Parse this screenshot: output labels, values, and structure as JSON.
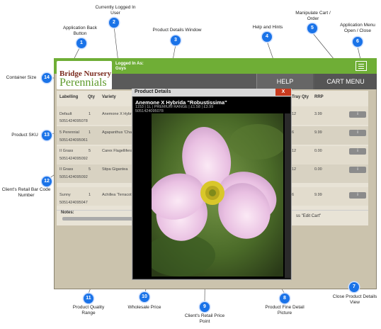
{
  "app": {
    "logo_line1": "Bridge Nursery",
    "logo_line2": "Perennials",
    "logged_in_label": "Logged In As:",
    "logged_in_user": "Guys",
    "help_label": "HELP",
    "cart_label": "CART MENU",
    "brand_color": "#6fae36"
  },
  "table": {
    "headers": [
      "Labelling",
      "Qty",
      "Variety",
      "Tray Qty",
      "RRP"
    ],
    "rows": [
      {
        "labelling": "Default",
        "qty": "1",
        "variety": "Anemone X Hybr...",
        "barcode": "5051424095078",
        "tray_qty": "12",
        "rrp": "3.99"
      },
      {
        "labelling": "5 Perennial",
        "qty": "1",
        "variety": "Agapanthus 'Cha...",
        "barcode": "5051424095061",
        "tray_qty": "6",
        "rrp": "9.99"
      },
      {
        "labelling": "II Grass",
        "qty": "5",
        "variety": "Carex Flagellifera",
        "barcode": "5051424095092",
        "tray_qty": "12",
        "rrp": "0.00"
      },
      {
        "labelling": "II Grass",
        "qty": "5",
        "variety": "Stipa Gigantea",
        "barcode": "5051424095092",
        "tray_qty": "12",
        "rrp": "0.00"
      },
      {
        "labelling": "Sunny",
        "qty": "1",
        "variety": "Achillea 'Terracott...",
        "barcode": "5051424095047",
        "tray_qty": "6",
        "rrp": "9.99"
      }
    ],
    "info_label": "i",
    "notes_label": "Notes:",
    "edit_cart_hint": "ss \"Edit Cart\""
  },
  "modal": {
    "title": "Product Details",
    "close_label": "X",
    "product_name": "Anemone X Hybrida \"Robustissima\"",
    "product_info": "1153 | 1L | PREMIUM RANGE | £1.58 | £3.99",
    "product_barcode": "5051424095078"
  },
  "annotations": [
    {
      "num": "1",
      "text": "Application Back Button"
    },
    {
      "num": "2",
      "text": "Currently Logged In User"
    },
    {
      "num": "3",
      "text": "Product Details Window"
    },
    {
      "num": "4",
      "text": "Help and Hints"
    },
    {
      "num": "5",
      "text": "Manipulate Cart / Order"
    },
    {
      "num": "6",
      "text": "Application Menu Open / Close"
    },
    {
      "num": "7",
      "text": "Close Product Details View"
    },
    {
      "num": "8",
      "text": "Product Fine Detail Picture"
    },
    {
      "num": "9",
      "text": "Client's Retail Price Point"
    },
    {
      "num": "10",
      "text": "Wholesale Price"
    },
    {
      "num": "11",
      "text": "Product Quality Range"
    },
    {
      "num": "12",
      "text": "Client's Retail Bar Code Number"
    },
    {
      "num": "13",
      "text": "Product SKU"
    },
    {
      "num": "14",
      "text": "Container Size"
    }
  ],
  "annotation_color": "#1a73e8"
}
